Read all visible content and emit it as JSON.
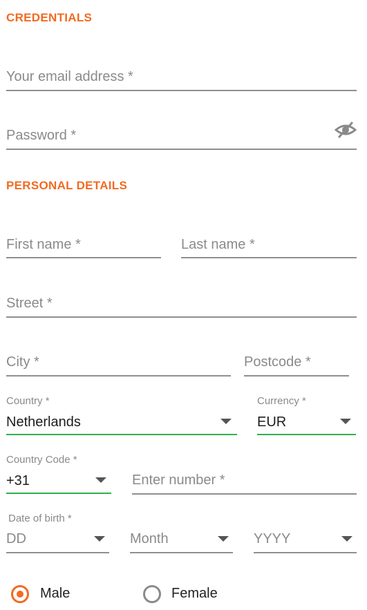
{
  "credentials": {
    "title": "CREDENTIALS",
    "email_placeholder": "Your email address *",
    "password_placeholder": "Password *",
    "password_icon": "eye-slash-icon"
  },
  "personal": {
    "title": "PERSONAL DETAILS",
    "first_name_placeholder": "First name *",
    "last_name_placeholder": "Last name *",
    "street_placeholder": "Street *",
    "city_placeholder": "City *",
    "postcode_placeholder": "Postcode *",
    "country": {
      "label": "Country *",
      "value": "Netherlands"
    },
    "currency": {
      "label": "Currency *",
      "value": "EUR"
    },
    "country_code": {
      "label": "Country Code *",
      "value": "+31"
    },
    "phone_placeholder": "Enter number *",
    "dob": {
      "label": "Date of birth *",
      "day_placeholder": "DD",
      "month_placeholder": "Month",
      "year_placeholder": "YYYY"
    },
    "gender": {
      "options": [
        "Male",
        "Female"
      ],
      "selected": "Male"
    }
  },
  "colors": {
    "accent": "#f26a21",
    "valid_underline": "#2db14a",
    "underline": "#8f8f8f"
  }
}
